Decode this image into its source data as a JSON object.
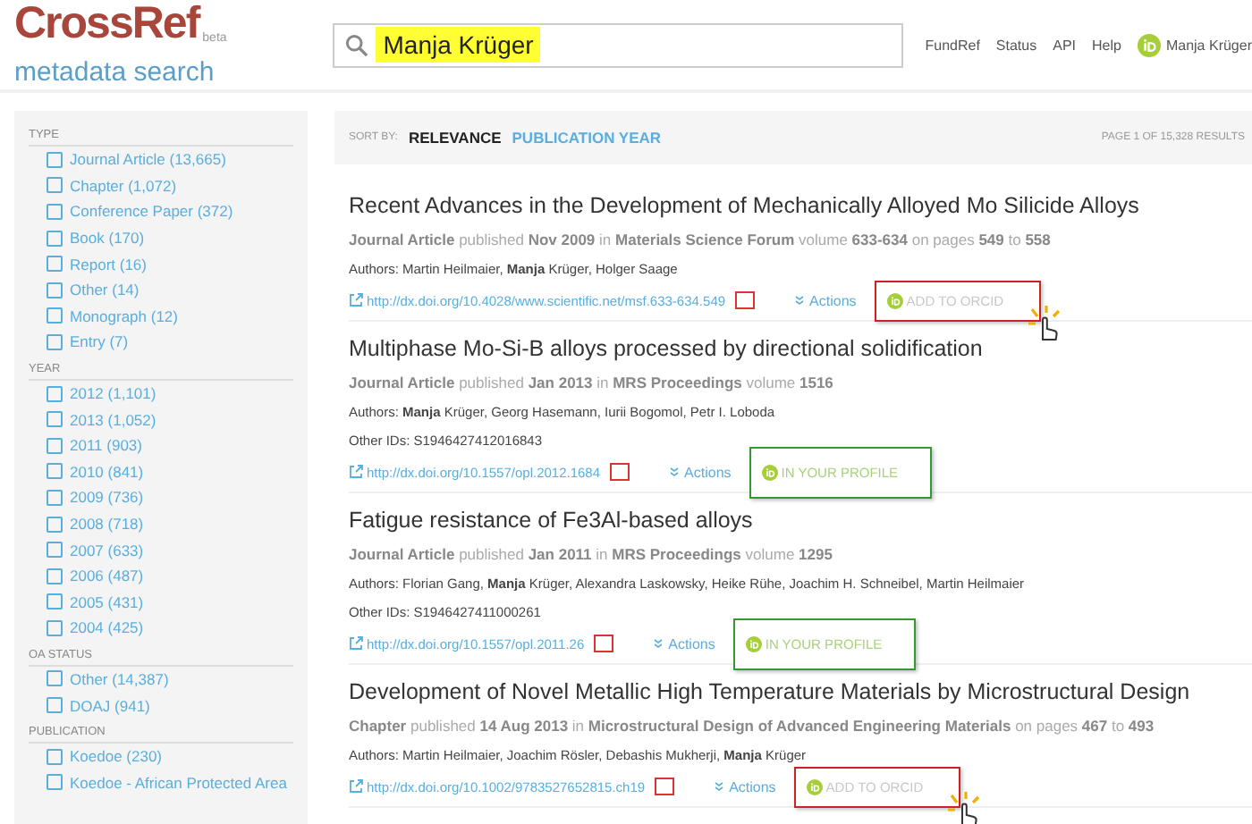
{
  "logo": {
    "brand": "CrossRef",
    "badge": "beta",
    "subtitle": "metadata search"
  },
  "search": {
    "value": "Manja Krüger"
  },
  "nav": {
    "links": [
      "FundRef",
      "Status",
      "API",
      "Help"
    ],
    "user": "Manja Krüger"
  },
  "sidebar": {
    "sections": [
      {
        "heading": "TYPE",
        "items": [
          {
            "label": "Journal Article (13,665)",
            "checked": false
          },
          {
            "label": "Chapter (1,072)",
            "checked": false
          },
          {
            "label": "Conference Paper (372)",
            "checked": false
          },
          {
            "label": "Book (170)",
            "checked": false
          },
          {
            "label": "Report (16)",
            "checked": false
          },
          {
            "label": "Other (14)",
            "checked": false
          },
          {
            "label": "Monograph (12)",
            "checked": false
          },
          {
            "label": "Entry (7)",
            "checked": false
          }
        ]
      },
      {
        "heading": "YEAR",
        "items": [
          {
            "label": "2012 (1,101)",
            "checked": false
          },
          {
            "label": "2013 (1,052)",
            "checked": false
          },
          {
            "label": "2011 (903)",
            "checked": false
          },
          {
            "label": "2010 (841)",
            "checked": false
          },
          {
            "label": "2009 (736)",
            "checked": false
          },
          {
            "label": "2008 (718)",
            "checked": false
          },
          {
            "label": "2007 (633)",
            "checked": false
          },
          {
            "label": "2006 (487)",
            "checked": false
          },
          {
            "label": "2005 (431)",
            "checked": false
          },
          {
            "label": "2004 (425)",
            "checked": false
          }
        ]
      },
      {
        "heading": "OA STATUS",
        "items": [
          {
            "label": "Other (14,387)",
            "checked": false
          },
          {
            "label": "DOAJ (941)",
            "checked": false
          }
        ]
      },
      {
        "heading": "PUBLICATION",
        "items": [
          {
            "label": "Koedoe (230)",
            "checked": false
          },
          {
            "label": "Koedoe - African Protected Area",
            "checked": false
          }
        ]
      }
    ]
  },
  "sort_bar": {
    "label": "SORT BY:",
    "options": [
      {
        "label": "RELEVANCE",
        "selected": true
      },
      {
        "label": "PUBLICATION YEAR",
        "selected": false
      }
    ],
    "page_info": "PAGE 1 OF 15,328 RESULTS"
  },
  "results": [
    {
      "title": "Recent Advances in the Development of Mechanically Alloyed Mo Silicide Alloys",
      "meta": "**Journal Article** published **Nov 2009** in **Materials Science Forum** volume **633-634** on pages **549** to **558**",
      "authors": "Authors: Martin Heilmaier, **Manja** Krüger, Holger Saage",
      "doi": "http://dx.doi.org/10.4028/www.scientific.net/msf.633-634.549",
      "actions": "Actions",
      "orcid": {
        "kind": "add",
        "label": "ADD TO ORCID"
      }
    },
    {
      "title": "Multiphase Mo-Si-B alloys processed by directional solidification",
      "meta": "**Journal Article** published **Jan 2013** in **MRS Proceedings** volume **1516**",
      "authors": "Authors: **Manja** Krüger, Georg Hasemann, Iurii Bogomol, Petr I. Loboda",
      "other_ids": "Other IDs: S1946427412016843",
      "doi": "http://dx.doi.org/10.1557/opl.2012.1684",
      "actions": "Actions",
      "orcid": {
        "kind": "profile",
        "label": "IN YOUR PROFILE"
      }
    },
    {
      "title": "Fatigue resistance of Fe3Al-based alloys",
      "meta": "**Journal Article** published **Jan 2011** in **MRS Proceedings** volume **1295**",
      "authors": "Authors: Florian Gang, **Manja** Krüger, Alexandra Laskowsky, Heike Rühe, Joachim H. Schneibel, Martin Heilmaier",
      "other_ids": "Other IDs: S1946427411000261",
      "doi": "http://dx.doi.org/10.1557/opl.2011.26",
      "actions": "Actions",
      "orcid": {
        "kind": "profile",
        "label": "IN YOUR PROFILE"
      }
    },
    {
      "title": "Development of Novel Metallic High Temperature Materials by Microstructural Design",
      "meta": "**Chapter** published **14 Aug 2013** in **Microstructural Design of Advanced Engineering Materials** on pages **467** to **493**",
      "authors": "Authors: Martin Heilmaier, Joachim Rösler, Debashis Mukherji, **Manja** Krüger",
      "doi": "http://dx.doi.org/10.1002/9783527652815.ch19",
      "actions": "Actions",
      "orcid": {
        "kind": "add",
        "label": "ADD TO ORCID"
      }
    }
  ]
}
